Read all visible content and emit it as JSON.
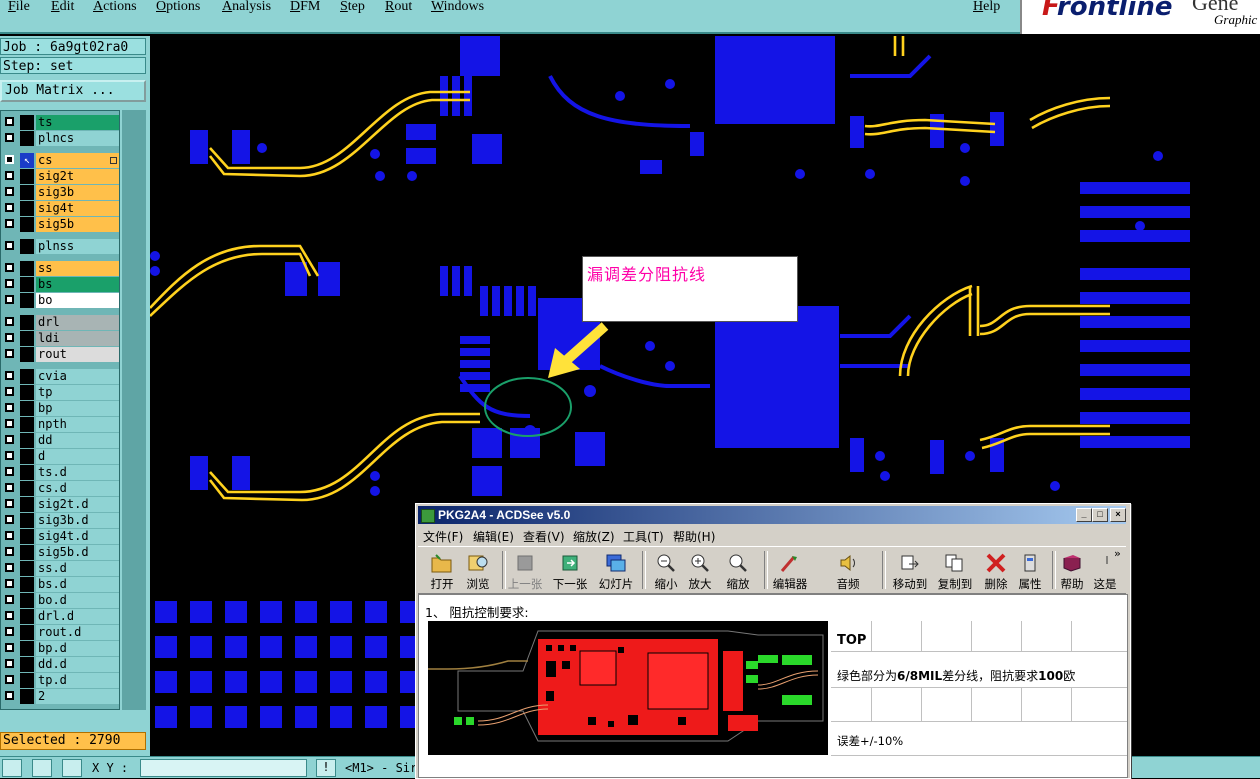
{
  "menu": {
    "items": [
      "File",
      "Edit",
      "Actions",
      "Options",
      "Analysis",
      "DFM",
      "Step",
      "Rout",
      "Windows"
    ],
    "help": "Help"
  },
  "brand": {
    "name": "Frontline",
    "sub_partial": "Gene",
    "sub2_partial": "Graphic"
  },
  "job": {
    "label": "Job : 6a9gt02ra0",
    "step": "Step: set",
    "matrix_button": "Job Matrix ..."
  },
  "layers": [
    {
      "name": "ts",
      "color": "#1aa06a"
    },
    {
      "name": "plncs",
      "color": "#8fd3d3"
    },
    {
      "name": "cs",
      "color": "#ffc04a",
      "active": true
    },
    {
      "name": "sig2t",
      "color": "#ffc04a"
    },
    {
      "name": "sig3b",
      "color": "#ffc04a"
    },
    {
      "name": "sig4t",
      "color": "#ffc04a"
    },
    {
      "name": "sig5b",
      "color": "#ffc04a"
    },
    {
      "name": "plnss",
      "color": "#8fd3d3"
    },
    {
      "name": "ss",
      "color": "#ffc04a"
    },
    {
      "name": "bs",
      "color": "#1aa06a"
    },
    {
      "name": "bo",
      "color": "#ffffff"
    },
    {
      "name": "drl",
      "color": "#a8b4b4"
    },
    {
      "name": "ldi",
      "color": "#a8b4b4"
    },
    {
      "name": "rout",
      "color": "#dcdcdc"
    },
    {
      "name": "cvia",
      "color": "#8fd3d3"
    },
    {
      "name": "tp",
      "color": "#8fd3d3"
    },
    {
      "name": "bp",
      "color": "#8fd3d3"
    },
    {
      "name": "npth",
      "color": "#8fd3d3"
    },
    {
      "name": "dd",
      "color": "#8fd3d3"
    },
    {
      "name": "d",
      "color": "#8fd3d3"
    },
    {
      "name": "ts.d",
      "color": "#8fd3d3"
    },
    {
      "name": "cs.d",
      "color": "#8fd3d3"
    },
    {
      "name": "sig2t.d",
      "color": "#8fd3d3"
    },
    {
      "name": "sig3b.d",
      "color": "#8fd3d3"
    },
    {
      "name": "sig4t.d",
      "color": "#8fd3d3"
    },
    {
      "name": "sig5b.d",
      "color": "#8fd3d3"
    },
    {
      "name": "ss.d",
      "color": "#8fd3d3"
    },
    {
      "name": "bs.d",
      "color": "#8fd3d3"
    },
    {
      "name": "bo.d",
      "color": "#8fd3d3"
    },
    {
      "name": "drl.d",
      "color": "#8fd3d3"
    },
    {
      "name": "rout.d",
      "color": "#8fd3d3"
    },
    {
      "name": "bp.d",
      "color": "#8fd3d3"
    },
    {
      "name": "dd.d",
      "color": "#8fd3d3"
    },
    {
      "name": "tp.d",
      "color": "#8fd3d3"
    },
    {
      "name": "2",
      "color": "#8fd3d3"
    }
  ],
  "selected": "Selected : 2790",
  "status": {
    "xy_label": "X Y :",
    "mode": "<M1> - Sir"
  },
  "callout": {
    "text": "漏调差分阻抗线"
  },
  "acdsee": {
    "title": "PKG2A4 - ACDSee v5.0",
    "menu": [
      "文件(F)",
      "编辑(E)",
      "查看(V)",
      "缩放(Z)",
      "工具(T)",
      "帮助(H)"
    ],
    "toolbar": [
      {
        "label": "打开",
        "icon": "folder-open-icon"
      },
      {
        "label": "浏览",
        "icon": "browse-icon"
      },
      {
        "label": "上一张",
        "icon": "prev-image-icon",
        "disabled": true
      },
      {
        "label": "下一张",
        "icon": "next-image-icon"
      },
      {
        "label": "幻灯片",
        "icon": "slideshow-icon"
      },
      {
        "label": "缩小",
        "icon": "zoom-out-icon"
      },
      {
        "label": "放大",
        "icon": "zoom-in-icon"
      },
      {
        "label": "缩放",
        "icon": "zoom-icon"
      },
      {
        "label": "编辑器",
        "icon": "editor-icon"
      },
      {
        "label": "音频",
        "icon": "audio-icon"
      },
      {
        "label": "移动到",
        "icon": "move-to-icon"
      },
      {
        "label": "复制到",
        "icon": "copy-to-icon"
      },
      {
        "label": "删除",
        "icon": "delete-icon"
      },
      {
        "label": "属性",
        "icon": "properties-icon"
      },
      {
        "label": "帮助",
        "icon": "help-book-icon"
      },
      {
        "label": "这是",
        "icon": "whats-this-icon"
      }
    ],
    "doc": {
      "heading": "1、 阻抗控制要求:",
      "top_label": "TOP",
      "desc_pre": "绿色部分为",
      "desc_spec": "6/8MIL",
      "desc_mid": "差分线，阻抗要求",
      "desc_val": "100",
      "desc_post": "欧",
      "tolerance": "误差+/-10%"
    }
  }
}
